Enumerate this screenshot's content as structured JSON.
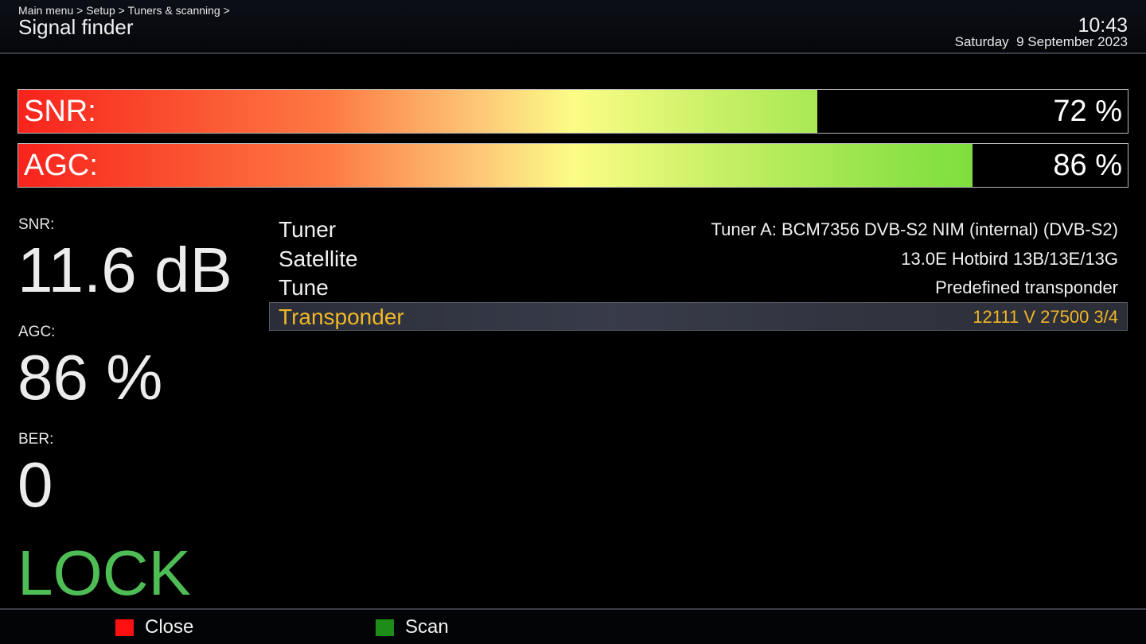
{
  "header": {
    "breadcrumb": "Main menu > Setup > Tuners & scanning >",
    "title": "Signal finder",
    "time": "10:43",
    "date": "Saturday  9 September 2023"
  },
  "bars": {
    "snr": {
      "label": "SNR:",
      "value_text": "72 %",
      "level": 0.72
    },
    "agc": {
      "label": "AGC:",
      "value_text": "86 %",
      "level": 0.86
    }
  },
  "readouts": {
    "snr_label": "SNR:",
    "snr_value": "11.6 dB",
    "agc_label": "AGC:",
    "agc_value": "86 %",
    "ber_label": "BER:",
    "ber_value": "0",
    "lock_status": "LOCK"
  },
  "info": [
    {
      "key": "Tuner",
      "value": "Tuner A: BCM7356 DVB-S2 NIM (internal) (DVB-S2)"
    },
    {
      "key": "Satellite",
      "value": "13.0E Hotbird 13B/13E/13G"
    },
    {
      "key": "Tune",
      "value": "Predefined transponder"
    },
    {
      "key": "Transponder",
      "value": "12111 V 27500 3/4"
    }
  ],
  "footer": {
    "close_label": "Close",
    "scan_label": "Scan"
  },
  "colors": {
    "red_key": "#ff1010",
    "green_key": "#1e8c18",
    "lock": "#4fbd55",
    "selected_text": "#f0b726"
  }
}
